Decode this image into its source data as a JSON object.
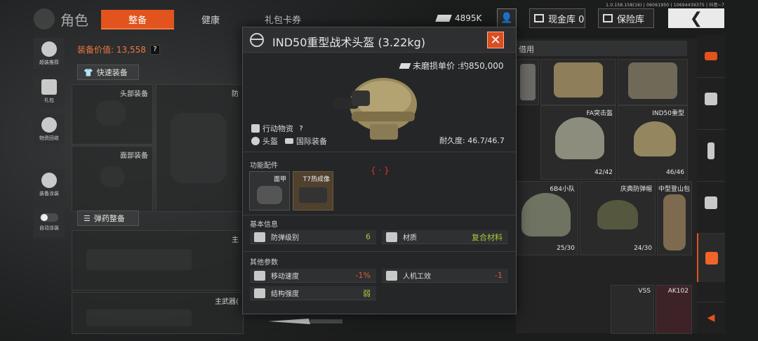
{
  "version_text": "1.0.158.158(16) | 06061950 | 10694439375 | 抖音~7",
  "top": {
    "title": "角色",
    "tabs": [
      {
        "label": "整备",
        "active": true
      },
      {
        "label": "健康",
        "active": false
      },
      {
        "label": "礼包卡券",
        "active": false
      }
    ],
    "currency_value": "4895K",
    "cash_vault_label": "现金库 0",
    "safe_label": "保险库",
    "back_symbol": "❮"
  },
  "left_nav": [
    {
      "label": "超装推荐",
      "icon": "recommend-icon"
    },
    {
      "label": "礼包",
      "icon": "gift-icon"
    },
    {
      "label": "物资回收",
      "icon": "recycle-icon"
    },
    {
      "label": "装备涂装",
      "icon": "paint-icon"
    },
    {
      "label": "自动涂装",
      "icon": "toggle-icon"
    }
  ],
  "equipment": {
    "value_label": "装备价值: 13,558",
    "help": "?",
    "quick_equip": "快速装备",
    "ammo_equip": "弹药整备",
    "slots": {
      "head": "头部装备",
      "armor": "防",
      "face": "面部装备",
      "main_weapon_top": "主",
      "main_weapon": "主武器("
    }
  },
  "inventory": {
    "header_text": "借用",
    "cells": [
      {
        "name": "",
        "durability": ""
      },
      {
        "name": "",
        "durability": ""
      },
      {
        "name": "",
        "durability": ""
      },
      {
        "name": "FA突击盔",
        "durability": "42/42"
      },
      {
        "name": "IND50重型",
        "durability": "46/46"
      },
      {
        "name": "6B4小队",
        "durability": "25/30"
      },
      {
        "name": "庆典防弹帽",
        "durability": "24/30"
      },
      {
        "name": "中型登山包",
        "durability": ""
      },
      {
        "name": "VSS",
        "durability": ""
      },
      {
        "name": "AK102",
        "durability": ""
      }
    ]
  },
  "modal": {
    "title": "IND50重型战术头盔 (3.22kg)",
    "close": "✕",
    "price_label": "未磨损单价 :约850,000",
    "supply_label": "行动物资",
    "help": "?",
    "slot_type": "头盔",
    "origin": "国际装备",
    "durability": "耐久度: 46.7/46.7",
    "attachments_title": "功能配件",
    "attachments": [
      {
        "name": "面甲"
      },
      {
        "name": "T7热成像"
      }
    ],
    "crosshair": "{ · }",
    "basic_title": "基本信息",
    "basic_stats": [
      {
        "label": "防弹级别",
        "value": "6",
        "color": "green"
      },
      {
        "label": "材质",
        "value": "复合材料",
        "color": "green"
      }
    ],
    "other_title": "其他参数",
    "other_stats": [
      {
        "label": "移动速度",
        "value": "-1%",
        "color": "red"
      },
      {
        "label": "人机工效",
        "value": "-1",
        "color": "red"
      },
      {
        "label": "结构强度",
        "value": "弱",
        "color": "green"
      }
    ]
  }
}
